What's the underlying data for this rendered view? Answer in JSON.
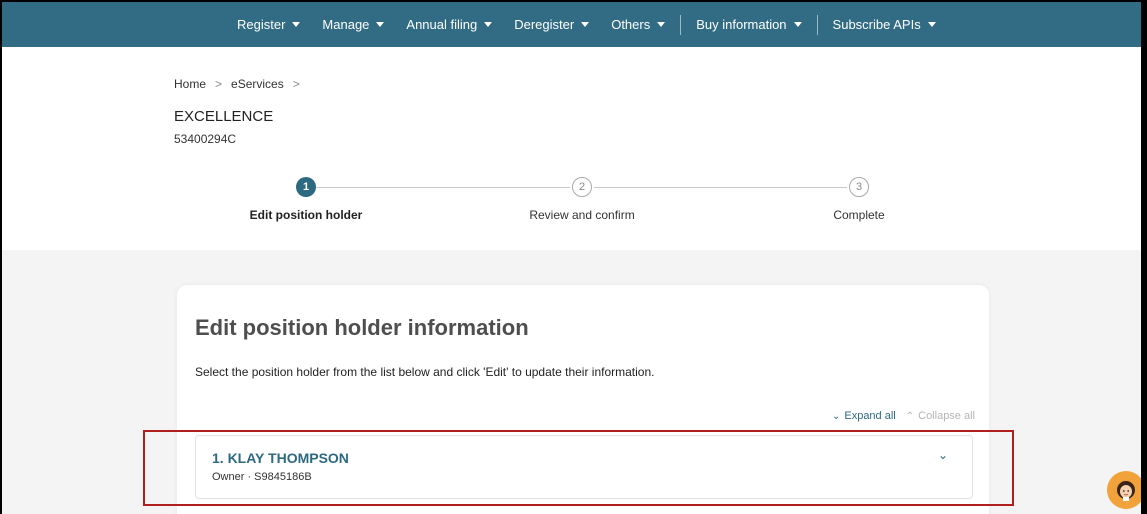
{
  "nav": {
    "items": [
      {
        "label": "Register",
        "dropdown": true
      },
      {
        "label": "Manage",
        "dropdown": true
      },
      {
        "label": "Annual filing",
        "dropdown": true
      },
      {
        "label": "Deregister",
        "dropdown": true
      },
      {
        "label": "Others",
        "dropdown": true
      },
      {
        "label": "Buy information",
        "dropdown": true
      },
      {
        "label": "Subscribe APIs",
        "dropdown": true
      }
    ]
  },
  "breadcrumb": [
    "Home",
    "eServices"
  ],
  "company": {
    "name": "EXCELLENCE",
    "uen": "53400294C"
  },
  "stepper": {
    "steps": [
      {
        "number": "1",
        "label": "Edit position holder",
        "active": true
      },
      {
        "number": "2",
        "label": "Review and confirm",
        "active": false
      },
      {
        "number": "3",
        "label": "Complete",
        "active": false
      }
    ]
  },
  "main": {
    "title": "Edit position holder information",
    "description": "Select the position holder from the list below and click 'Edit' to update their information.",
    "expand_all": "Expand all",
    "collapse_all": "Collapse all",
    "holders": [
      {
        "name": "1. KLAY THOMPSON",
        "role": "Owner · S9845186B"
      }
    ]
  },
  "colors": {
    "nav": "#316c84",
    "accent": "#2d6a82",
    "highlight": "#b01e1e"
  },
  "icons": {
    "assistant": "assistant-avatar-icon"
  }
}
